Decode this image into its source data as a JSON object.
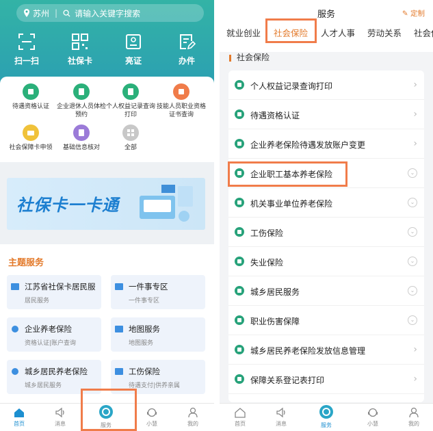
{
  "left": {
    "search": {
      "city": "苏州",
      "placeholder": "请输入关键字搜索"
    },
    "top_icons": [
      {
        "label": "扫一扫",
        "icon": "scan-icon"
      },
      {
        "label": "社保卡",
        "icon": "qrcode-icon"
      },
      {
        "label": "亮证",
        "icon": "id-card-icon"
      },
      {
        "label": "办件",
        "icon": "edit-doc-icon"
      }
    ],
    "grid": [
      {
        "label": "待遇资格认证",
        "icon": "shield-check-icon",
        "color": "#2bb07a"
      },
      {
        "label": "企业退休人员体检预约",
        "icon": "clipboard-icon",
        "color": "#2bb07a"
      },
      {
        "label": "个人权益记录查询打印",
        "icon": "document-icon",
        "color": "#2bb07a"
      },
      {
        "label": "技能人员职业资格证书查询",
        "icon": "certificate-icon",
        "color": "#f07c4a"
      },
      {
        "label": "社会保障卡申领",
        "icon": "card-icon",
        "color": "#f0c23a"
      },
      {
        "label": "基础信息核对",
        "icon": "info-check-icon",
        "color": "#9b7bd8"
      },
      {
        "label": "全部",
        "icon": "more-icon",
        "color": "#c8c8c8"
      }
    ],
    "banner": {
      "text": "社保卡一卡通"
    },
    "theme": {
      "title": "主题服务",
      "cards": [
        {
          "name": "江苏省社保卡居民服",
          "sub": "居民服务"
        },
        {
          "name": "一件事专区",
          "sub": "一件事专区"
        },
        {
          "name": "企业养老保险",
          "sub": "资格认证|账户查询"
        },
        {
          "name": "地图服务",
          "sub": "地图服务"
        },
        {
          "name": "城乡居民养老保险",
          "sub": "城乡居民服务"
        },
        {
          "name": "工伤保险",
          "sub": "待遇支付|供养亲属"
        }
      ]
    },
    "nav": [
      {
        "label": "首页",
        "icon": "home-icon"
      },
      {
        "label": "消息",
        "icon": "speaker-icon"
      },
      {
        "label": "服务",
        "icon": "service-logo-icon"
      },
      {
        "label": "小慧",
        "icon": "assistant-icon"
      },
      {
        "label": "我的",
        "icon": "user-icon"
      }
    ]
  },
  "right": {
    "title": "服务",
    "custom": "定制",
    "tabs": [
      "就业创业",
      "社会保险",
      "人才人事",
      "劳动关系",
      "社会保"
    ],
    "section": "社会保险",
    "items": [
      {
        "label": "个人权益记录查询打印",
        "action": "chevron"
      },
      {
        "label": "待遇资格认证",
        "action": "chevron"
      },
      {
        "label": "企业养老保险待遇发放账户变更",
        "action": "chevron"
      },
      {
        "label": "企业职工基本养老保险",
        "action": "expand"
      },
      {
        "label": "机关事业单位养老保险",
        "action": "expand"
      },
      {
        "label": "工伤保险",
        "action": "expand"
      },
      {
        "label": "失业保险",
        "action": "expand"
      },
      {
        "label": "城乡居民服务",
        "action": "expand"
      },
      {
        "label": "职业伤害保障",
        "action": "expand"
      },
      {
        "label": "城乡居民养老保险发放信息管理",
        "action": "chevron"
      },
      {
        "label": "保障关系登记表打印",
        "action": "chevron"
      }
    ],
    "nav": [
      {
        "label": "首页",
        "icon": "home-icon"
      },
      {
        "label": "消息",
        "icon": "speaker-icon"
      },
      {
        "label": "服务",
        "icon": "service-logo-icon"
      },
      {
        "label": "小慧",
        "icon": "assistant-icon"
      },
      {
        "label": "我的",
        "icon": "user-icon"
      }
    ]
  },
  "colors": {
    "accent": "#e37a2b",
    "teal": "#33b3a6",
    "highlight": "#f07c4a",
    "nav_active": "#1d8fd0"
  }
}
